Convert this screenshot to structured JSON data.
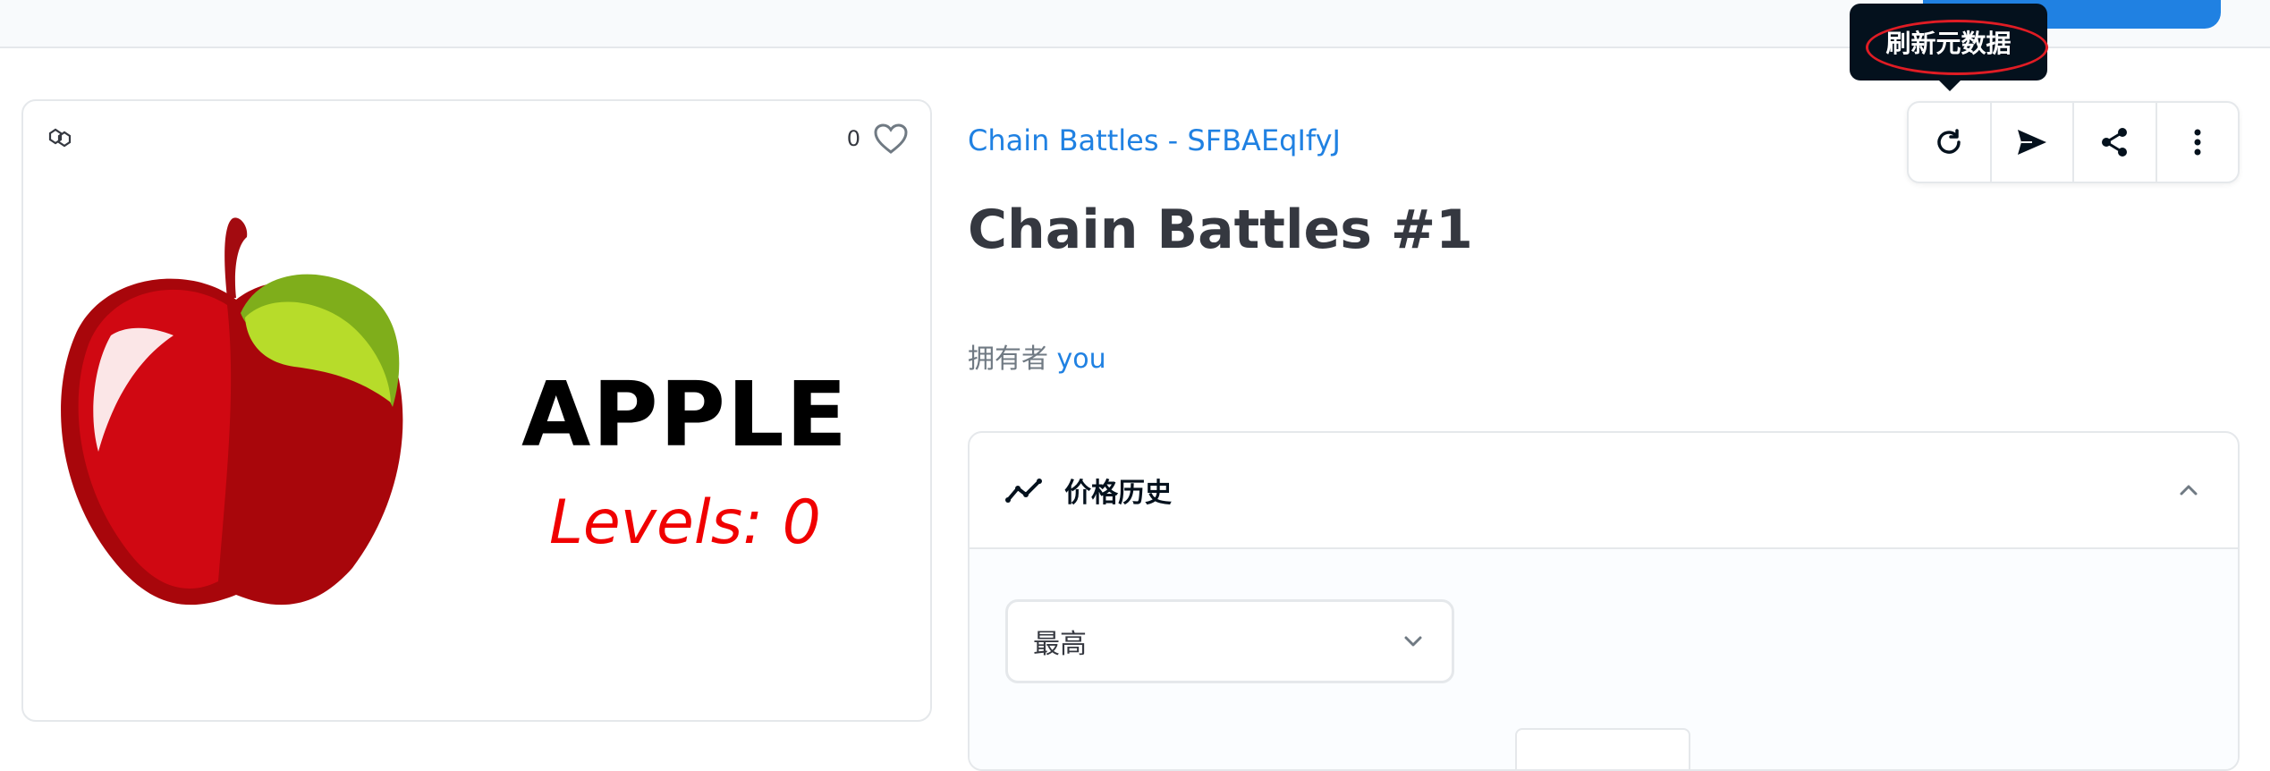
{
  "asset": {
    "collection_link": "Chain Battles - SFBAEqIfyJ",
    "title": "Chain Battles #1",
    "owner_prefix": "拥有者",
    "owner_name": "you",
    "favorite_count": "0"
  },
  "nft_image": {
    "name": "APPLE",
    "levels": "Levels: 0"
  },
  "actions": {
    "tooltip": "刷新元数据",
    "icons": [
      "refresh-icon",
      "send-icon",
      "share-icon",
      "more-vertical-icon"
    ]
  },
  "price_history": {
    "title": "价格历史",
    "filter_value": "最高"
  },
  "colors": {
    "link": "#2081e2",
    "level_text": "#f00000",
    "tooltip_bg": "#04111d",
    "highlight": "#e01c24"
  }
}
